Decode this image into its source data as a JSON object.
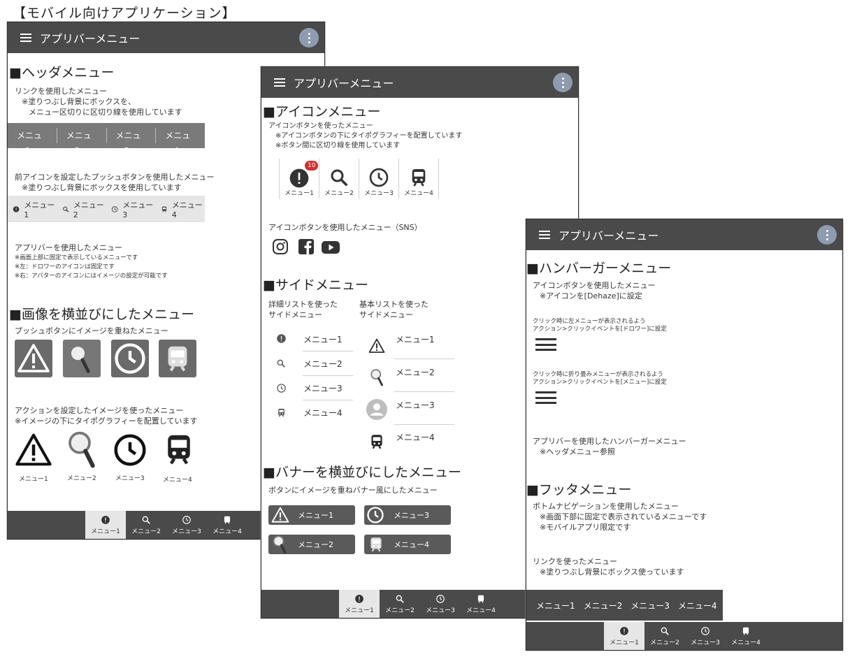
{
  "page_title": "【モバイル向けアプリケーション】",
  "appbar_title": "アプリバーメニュー",
  "menus": [
    "メニュー1",
    "メニュー2",
    "メニュー3",
    "メニュー4"
  ],
  "menus_dash": [
    "メニュー1",
    "メニュー2",
    "メニュー3",
    "メニュー4"
  ],
  "screen1": {
    "header_section": "■ヘッダメニュー",
    "link_desc": [
      "リンクを使用したメニュー",
      "※塗りつぶし背景にボックスを、",
      "メニュー区切りに区切り線を使用しています"
    ],
    "pushbtn_desc": [
      "前アイコンを設定したプッシュボタンを使用したメニュー",
      "※塗りつぶし背景にボックスを使用しています"
    ],
    "appbar_desc": [
      "アプリバーを使用したメニュー",
      "※画面上部に固定で表示しているメニューです",
      "※左：ドロワーのアイコンは固定です",
      "※右：アバターのアイコンにはイメージの設定が可能です"
    ],
    "image_section": "■画像を横並びにしたメニュー",
    "image_desc": "プッシュボタンにイメージを重ねたメニュー",
    "action_desc": [
      "アクションを設定したイメージを使ったメニュー",
      "※イメージの下にタイポグラフィーを配置しています"
    ]
  },
  "screen2": {
    "icon_section": "■アイコンメニュー",
    "icon_desc": [
      "アイコンボタンを使ったメニュー",
      "※アイコンボタンの下にタイポグラフィーを配置しています",
      "※ボタン間に区切り線を使用しています"
    ],
    "badge": "10",
    "sns_desc": "アイコンボタンを使用したメニュー（SNS）",
    "side_section": "■サイドメニュー",
    "detail_list": [
      "詳細リストを使った",
      "サイドメニュー"
    ],
    "basic_list": [
      "基本リストを使った",
      "サイドメニュー"
    ],
    "banner_section": "■バナーを横並びにしたメニュー",
    "banner_desc": "ボタンにイメージを重ねバナー風にしたメニュー"
  },
  "screen3": {
    "hamburger_section": "■ハンバーガーメニュー",
    "ham_desc": [
      "アイコンボタンを使用したメニュー",
      "※アイコンを[Dehaze]に設定"
    ],
    "drawer_desc": [
      "クリック時に左メニューが表示されるよう",
      "アクション>クリックイベントを[ドロワー]に設定"
    ],
    "fold_desc": [
      "クリック時に折り畳みメニューが表示されるよう",
      "アクション>クリックイベントを[メニュー]に設定"
    ],
    "appbar_ham_desc": [
      "アプリバーを使用したハンバーガーメニュー",
      "※ヘッダメニュー参照"
    ],
    "footer_section": "■フッタメニュー",
    "bottomnav_desc": [
      "ボトムナビゲーションを使用したメニュー",
      "※画面下部に固定で表示されているメニューです",
      "※モバイルアプリ限定です"
    ],
    "footlink_desc": [
      "リンクを使ったメニュー",
      "※塗りつぶし背景にボックス使っています"
    ]
  },
  "colors": {
    "appbar": "#4a4a4a",
    "badge": "#d32f2f",
    "avatar": "#8e9bb0"
  }
}
